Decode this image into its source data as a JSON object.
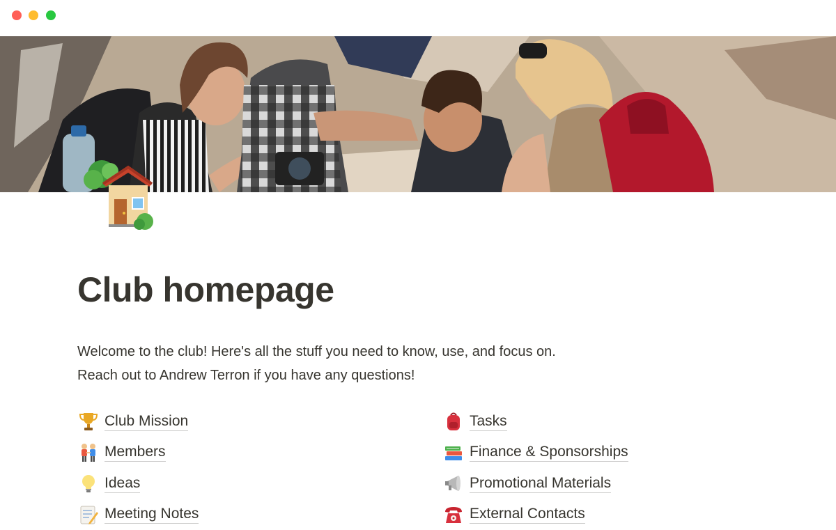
{
  "window": {
    "controls": [
      "close",
      "minimize",
      "zoom"
    ]
  },
  "cover": {
    "image": "photo of a group of laughing hikers with backpacks in a rocky canyon"
  },
  "page": {
    "icon": "house-with-garden-icon",
    "title": "Club homepage",
    "intro": [
      "Welcome to the club! Here's all the stuff you need to know, use, and focus on.",
      "Reach out to Andrew Terron if you have any questions!"
    ]
  },
  "links": {
    "left": [
      {
        "icon": "trophy-icon",
        "label": "Club Mission"
      },
      {
        "icon": "people-holding-hands-icon",
        "label": "Members"
      },
      {
        "icon": "light-bulb-icon",
        "label": "Ideas"
      },
      {
        "icon": "memo-icon",
        "label": "Meeting Notes"
      }
    ],
    "right": [
      {
        "icon": "backpack-icon",
        "label": "Tasks"
      },
      {
        "icon": "books-icon",
        "label": "Finance & Sponsorships"
      },
      {
        "icon": "megaphone-icon",
        "label": "Promotional Materials"
      },
      {
        "icon": "telephone-icon",
        "label": "External Contacts"
      }
    ]
  },
  "colors": {
    "text": "#37352f",
    "background": "#ffffff",
    "close": "#ff5f57",
    "minimize": "#febc2e",
    "zoom": "#28c840"
  }
}
